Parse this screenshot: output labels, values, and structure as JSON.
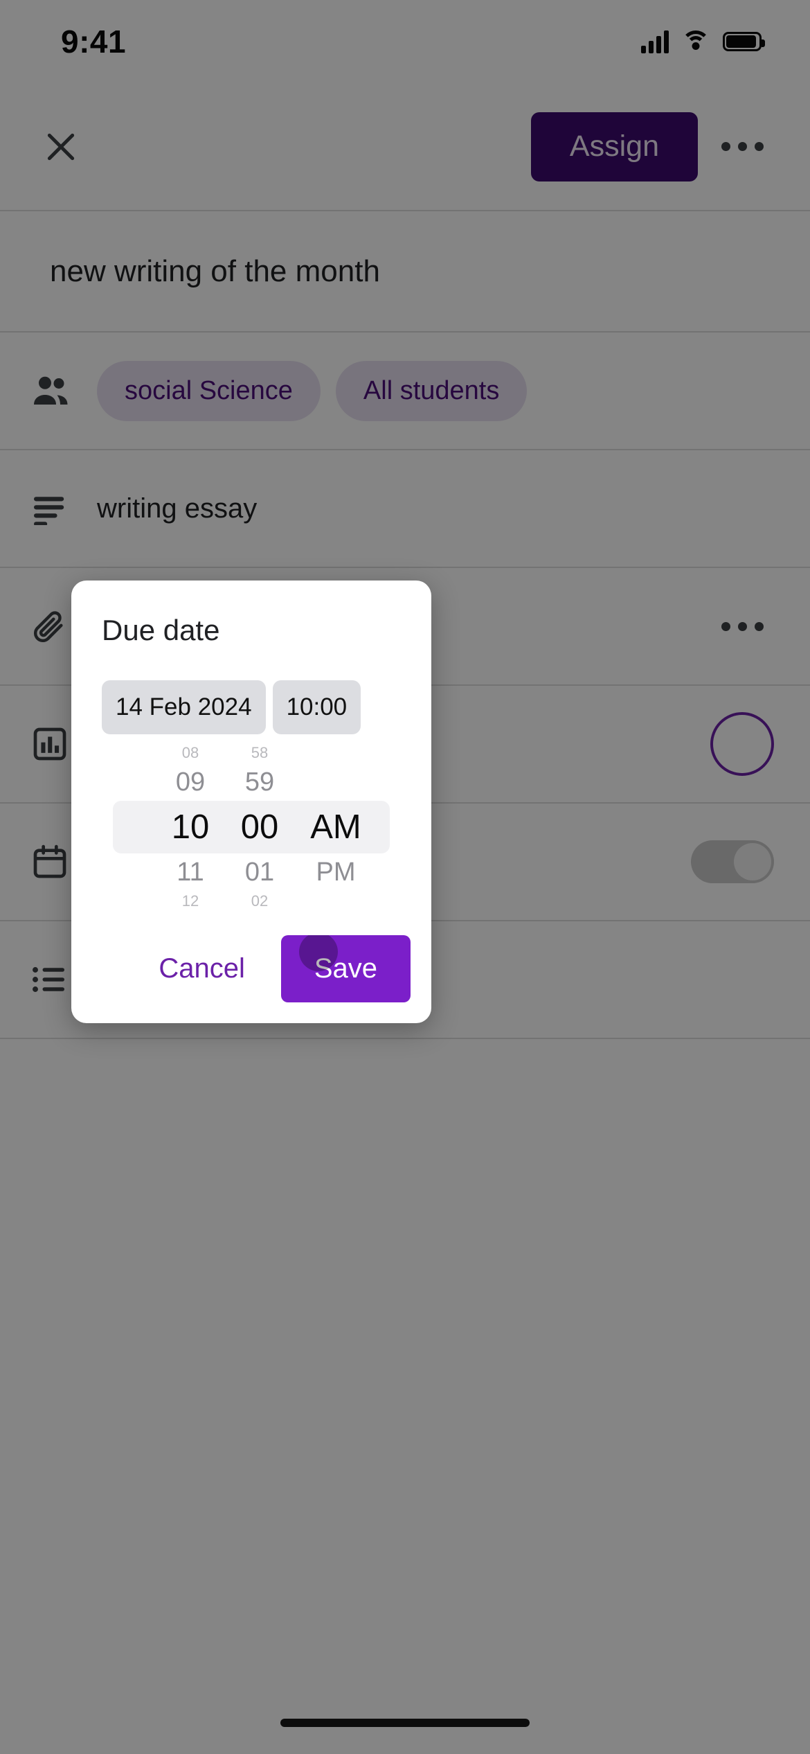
{
  "statusbar": {
    "time": "9:41",
    "signal_icon": "cellular-signal-icon",
    "wifi_icon": "wifi-icon",
    "battery_icon": "battery-icon"
  },
  "appbar": {
    "close_icon": "close-icon",
    "assign_label": "Assign",
    "overflow_icon": "more-options-icon"
  },
  "assignment": {
    "title": "new writing of the month",
    "audience_icon": "people-icon",
    "chips": [
      {
        "label": "social Science"
      },
      {
        "label": "All students"
      }
    ],
    "description_icon": "description-icon",
    "description": "writing essay",
    "attachment_icon": "attachment-icon",
    "attachment_overflow_icon": "more-options-icon",
    "points_icon": "points-icon",
    "due_icon": "calendar-icon",
    "topic_icon": "topic-list-icon"
  },
  "dialog": {
    "title": "Due date",
    "date_value": "14 Feb 2024",
    "time_value": "10:00",
    "cancel_label": "Cancel",
    "save_label": "Save",
    "picker": {
      "hours": {
        "far_above": "08",
        "above": "09",
        "selected": "10",
        "below": "11",
        "far_below": "12"
      },
      "minutes": {
        "far_above": "58",
        "above": "59",
        "selected": "00",
        "below": "01",
        "far_below": "02"
      },
      "meridiem": {
        "far_above": "",
        "above": "",
        "selected": "AM",
        "below": "PM",
        "far_below": ""
      }
    }
  },
  "colors": {
    "brand_purple": "#4b0f7a",
    "assign_button": "#3d0b6e",
    "save_button": "#7b1fc9",
    "chip_bg": "#e7dff0",
    "field_bg": "#dcdde1"
  },
  "homebar": "home-indicator"
}
